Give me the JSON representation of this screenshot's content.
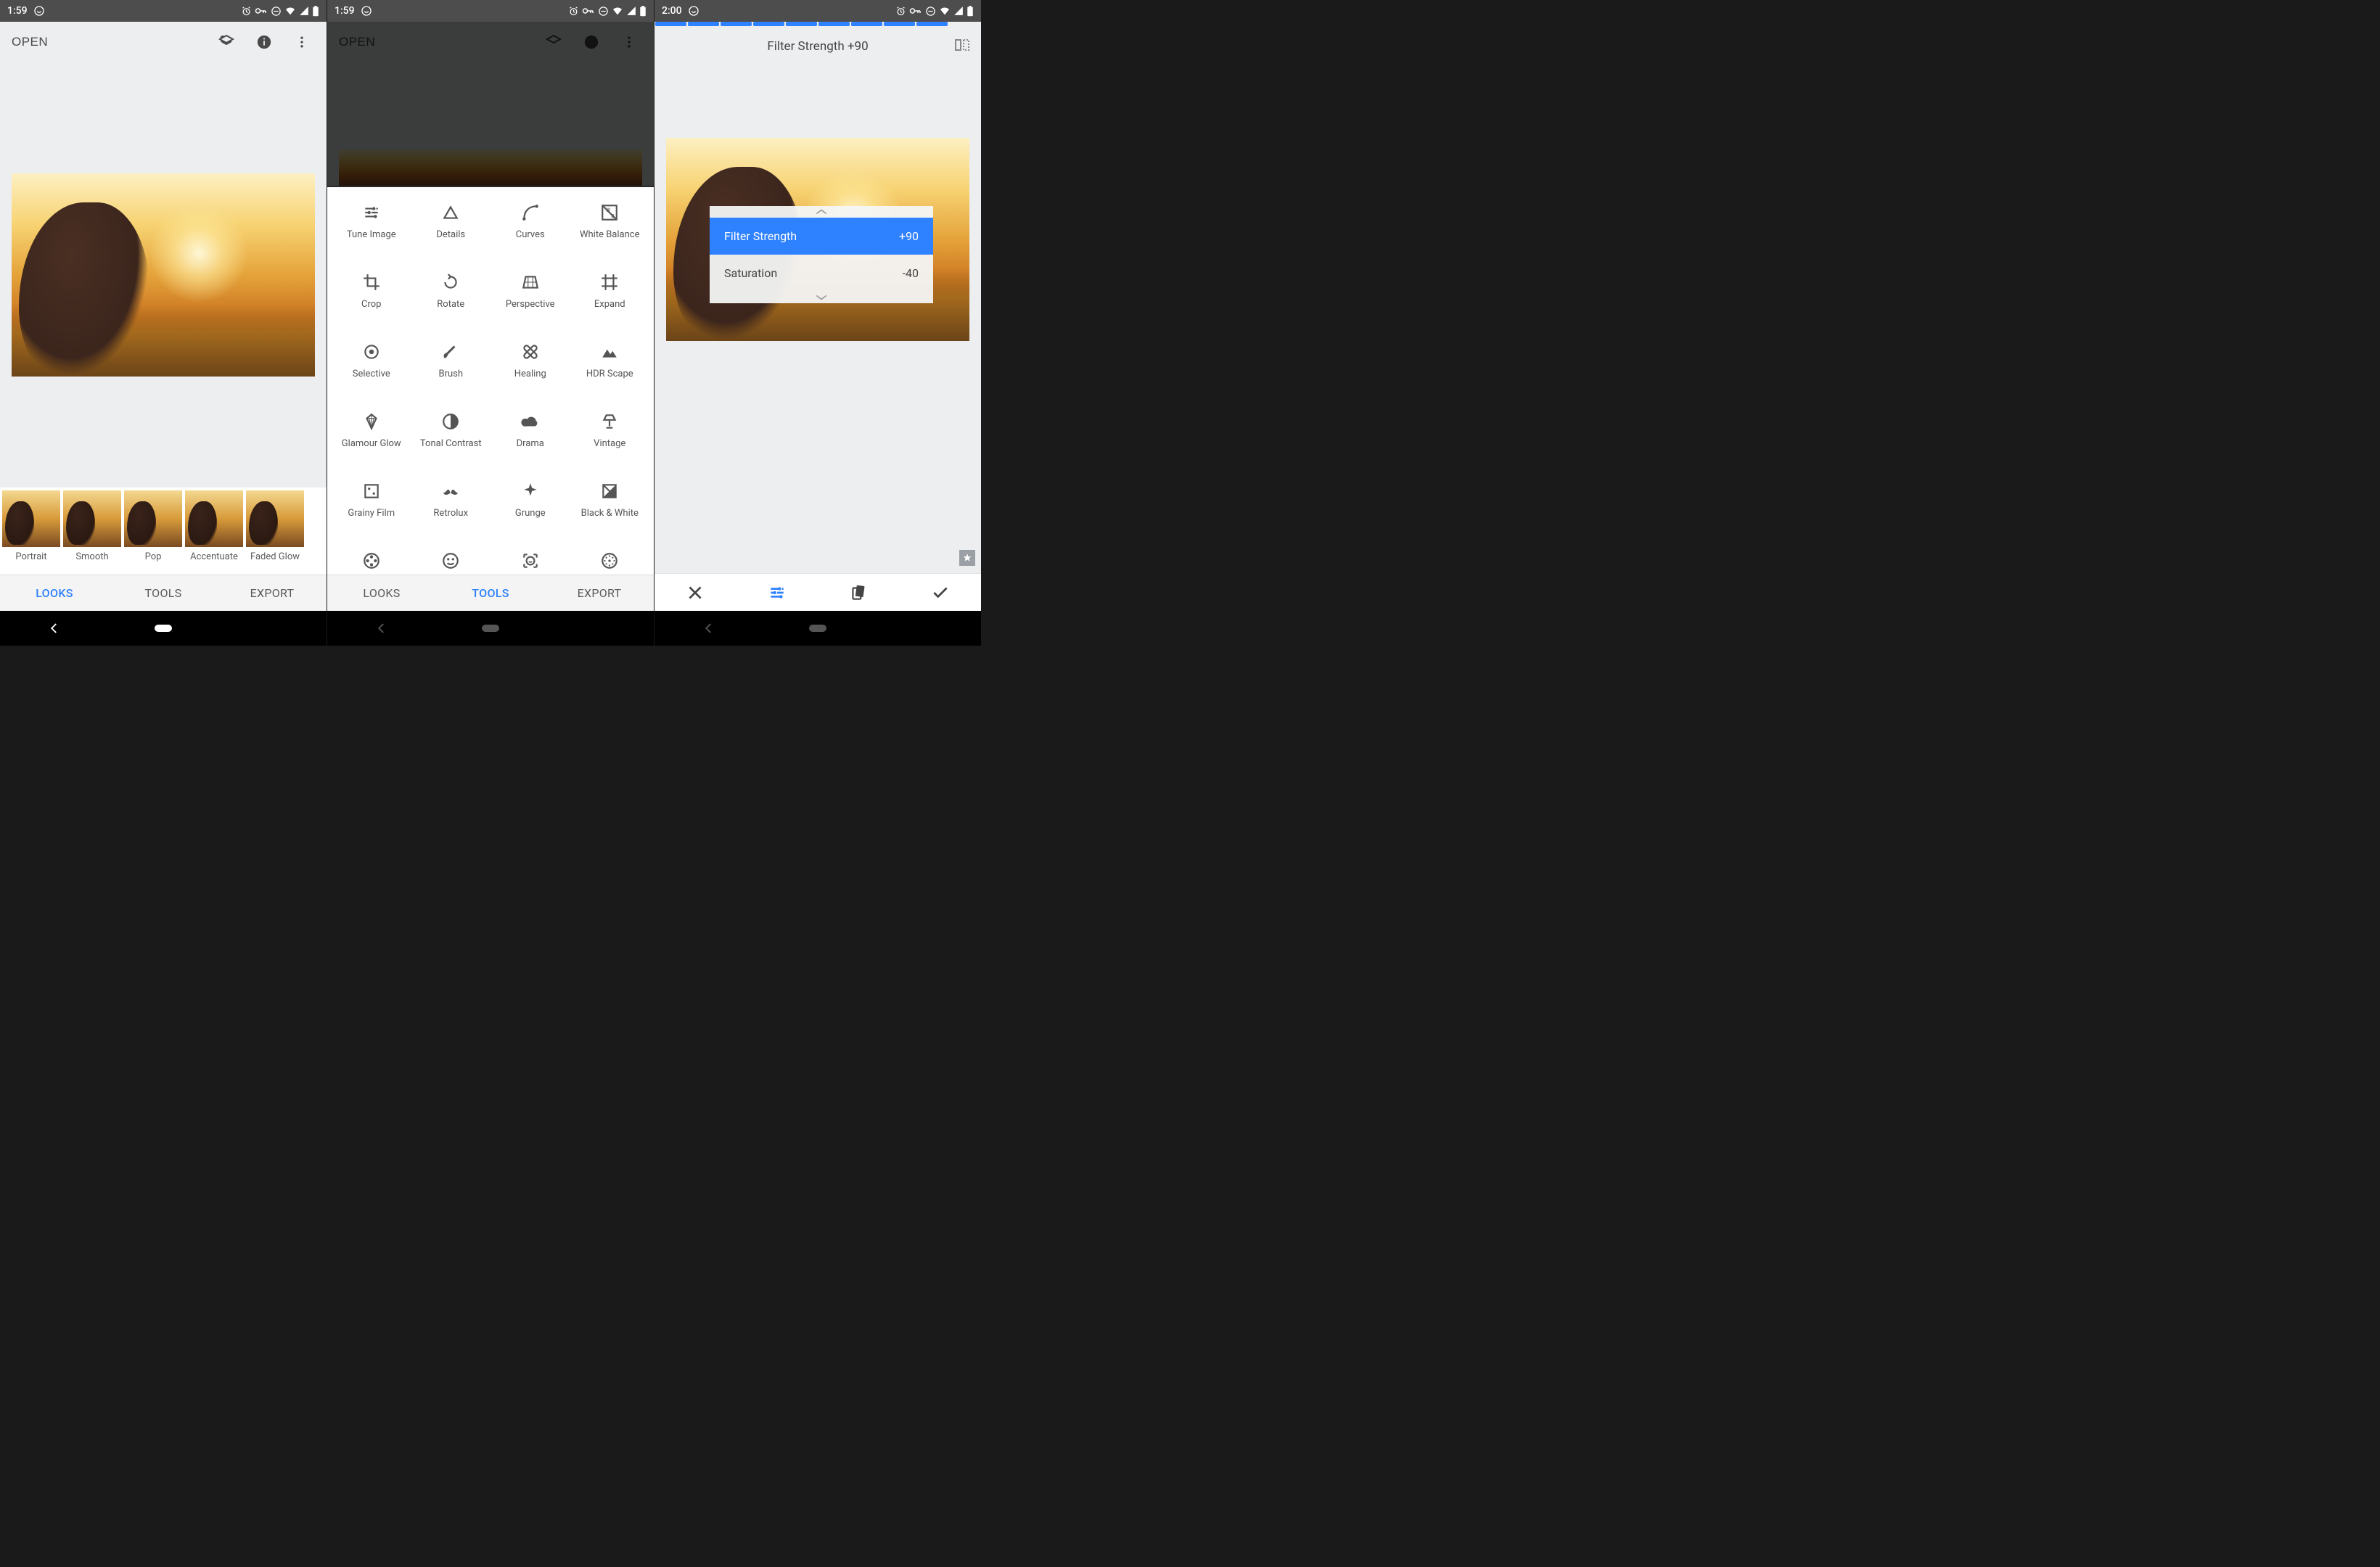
{
  "statusbar": {
    "time_a": "1:59",
    "time_b": "1:59",
    "time_c": "2:00"
  },
  "appbar": {
    "open": "OPEN"
  },
  "looks": [
    {
      "label": "Portrait"
    },
    {
      "label": "Smooth"
    },
    {
      "label": "Pop"
    },
    {
      "label": "Accentuate"
    },
    {
      "label": "Faded Glow"
    }
  ],
  "bottom_tabs": {
    "looks": "LOOKS",
    "tools": "TOOLS",
    "export": "EXPORT"
  },
  "tools": [
    {
      "label": "Tune Image",
      "icon": "sliders"
    },
    {
      "label": "Details",
      "icon": "triangle"
    },
    {
      "label": "Curves",
      "icon": "curve"
    },
    {
      "label": "White Balance",
      "icon": "wb"
    },
    {
      "label": "Crop",
      "icon": "crop"
    },
    {
      "label": "Rotate",
      "icon": "rotate"
    },
    {
      "label": "Perspective",
      "icon": "perspective"
    },
    {
      "label": "Expand",
      "icon": "expand"
    },
    {
      "label": "Selective",
      "icon": "target"
    },
    {
      "label": "Brush",
      "icon": "brush"
    },
    {
      "label": "Healing",
      "icon": "bandaid"
    },
    {
      "label": "HDR Scape",
      "icon": "mountain"
    },
    {
      "label": "Glamour Glow",
      "icon": "diamond"
    },
    {
      "label": "Tonal Contrast",
      "icon": "halfcircle"
    },
    {
      "label": "Drama",
      "icon": "cloud"
    },
    {
      "label": "Vintage",
      "icon": "lamp"
    },
    {
      "label": "Grainy Film",
      "icon": "film"
    },
    {
      "label": "Retrolux",
      "icon": "mustache"
    },
    {
      "label": "Grunge",
      "icon": "spark"
    },
    {
      "label": "Black & White",
      "icon": "bw"
    },
    {
      "label": "",
      "icon": "reel"
    },
    {
      "label": "",
      "icon": "face"
    },
    {
      "label": "",
      "icon": "smileframe"
    },
    {
      "label": "",
      "icon": "dotcircle"
    }
  ],
  "screen3": {
    "title": "Filter Strength +90",
    "rows": [
      {
        "name": "Filter Strength",
        "value": "+90",
        "active": true
      },
      {
        "name": "Saturation",
        "value": "-40",
        "active": false
      }
    ]
  }
}
